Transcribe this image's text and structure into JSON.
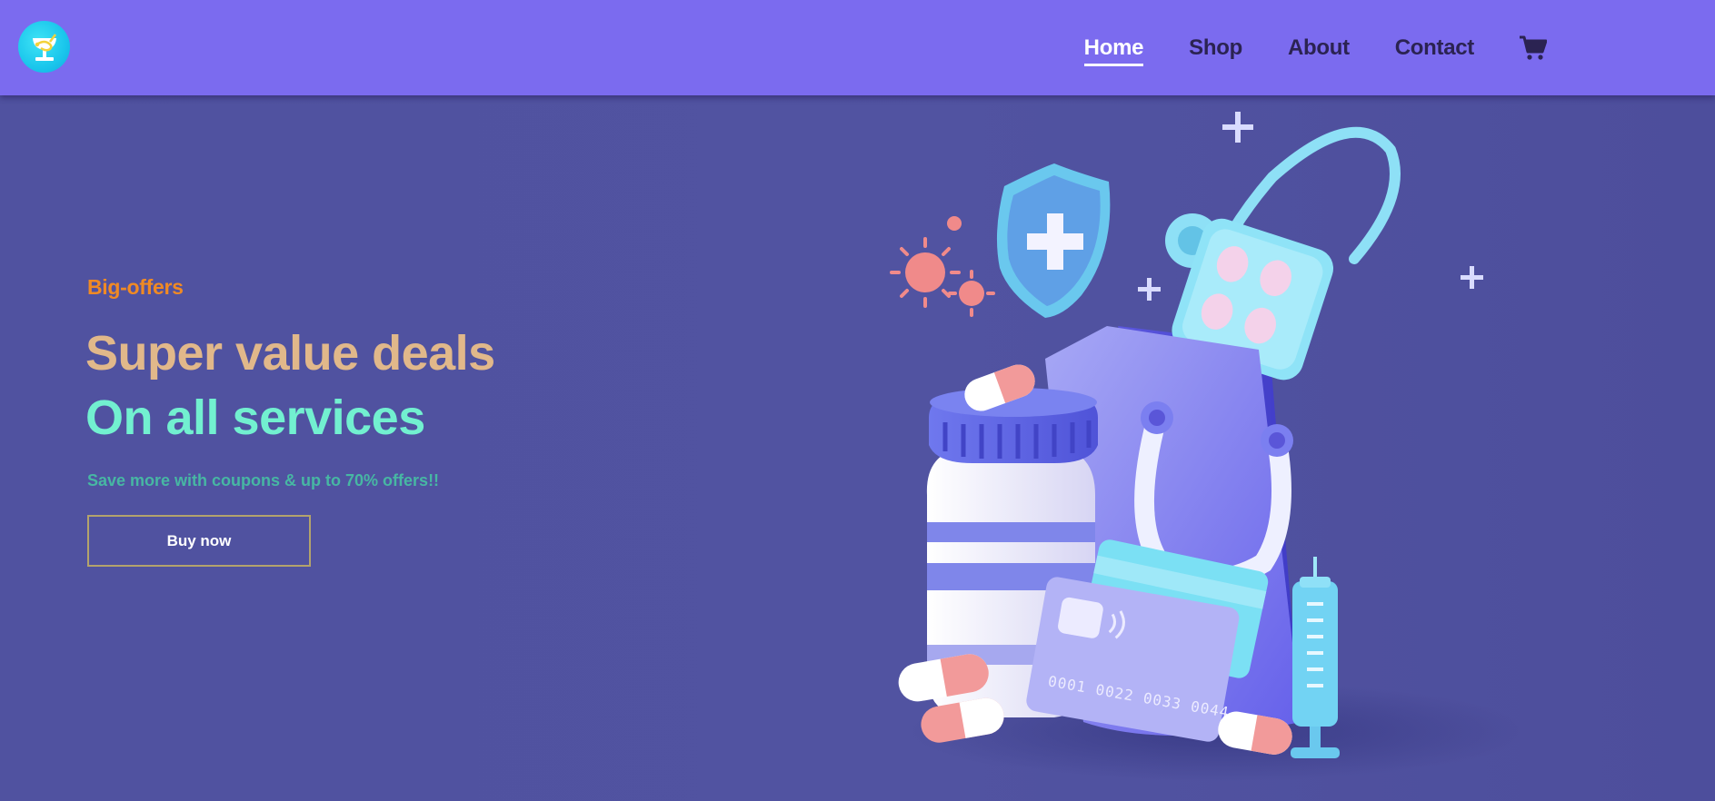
{
  "nav": {
    "logo_icon": "pharmacy-bowl-of-hygieia-icon",
    "links": [
      {
        "label": "Home",
        "active": true
      },
      {
        "label": "Shop",
        "active": false
      },
      {
        "label": "About",
        "active": false
      },
      {
        "label": "Contact",
        "active": false
      }
    ],
    "cart_icon": "shopping-cart-icon"
  },
  "hero": {
    "tag": "Big-offers",
    "headline": "Super value deals",
    "subheadline": "On all services",
    "description": "Save more with coupons & up to 70% offers!!",
    "cta_label": "Buy now",
    "illustration": "medical-shopping-illustration"
  },
  "colors": {
    "navbar": "#7b6bef",
    "hero_bg": "#5052a0",
    "tag": "#f08a24",
    "headline": "#e1b88a",
    "subheadline": "#72f0d0",
    "description": "#47b7a3"
  }
}
